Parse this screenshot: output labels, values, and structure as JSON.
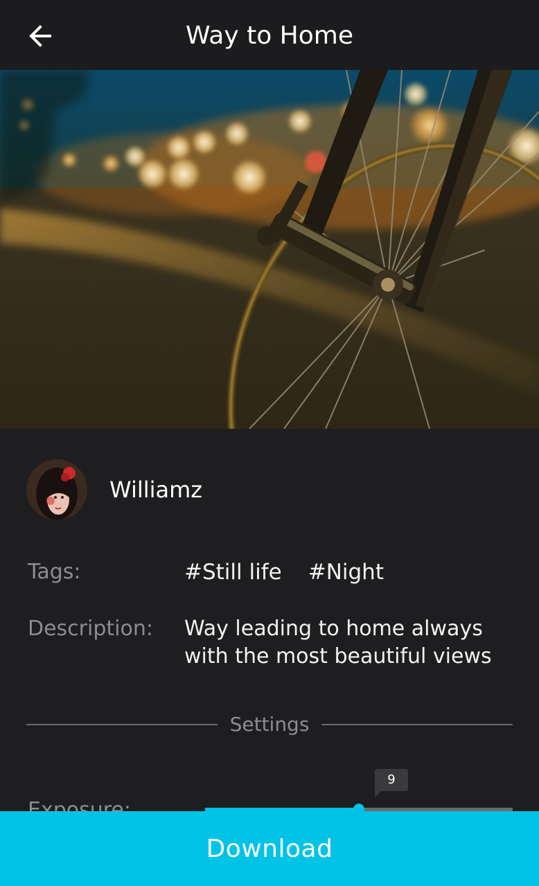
{
  "header": {
    "title": "Way to Home",
    "back_icon": "arrow-left-icon"
  },
  "author": {
    "name": "Williamz"
  },
  "tags": {
    "label": "Tags:",
    "items": [
      "#Still life",
      "#Night"
    ]
  },
  "description": {
    "label": "Description:",
    "text": "Way leading to home always with the most beautiful views"
  },
  "settings": {
    "label": "Settings",
    "exposure": {
      "label": "Exposure:",
      "value": "9",
      "fraction": 0.5
    }
  },
  "actions": {
    "download_label": "Download"
  },
  "colors": {
    "accent": "#00c3e6",
    "background": "#1e1e20",
    "muted_text": "#8d8d90"
  }
}
